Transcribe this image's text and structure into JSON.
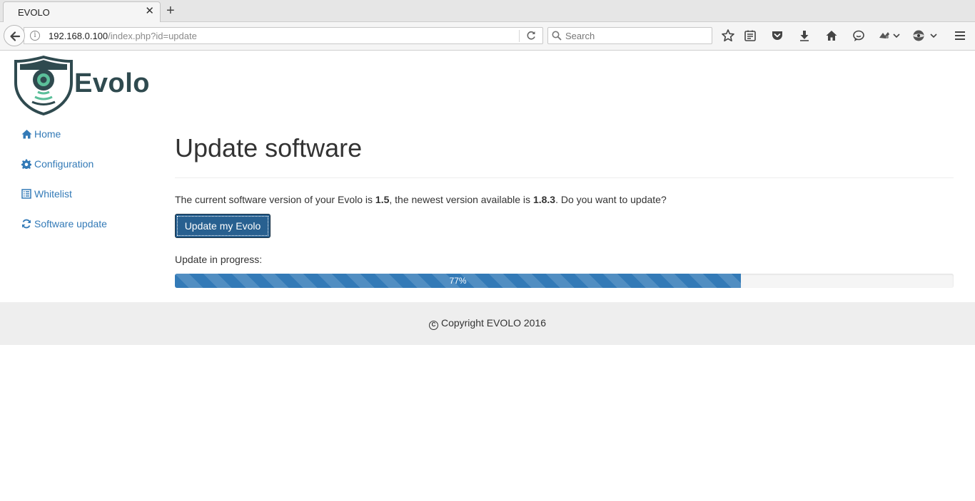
{
  "browser": {
    "tab_title": "EVOLO",
    "url_host": "192.168.0.100",
    "url_path": "/index.php?id=update",
    "search_placeholder": "Search"
  },
  "logo": {
    "text": "Evolo"
  },
  "sidebar": {
    "items": [
      {
        "label": "Home",
        "icon": "home-icon"
      },
      {
        "label": "Configuration",
        "icon": "gear-icon"
      },
      {
        "label": "Whitelist",
        "icon": "list-icon"
      },
      {
        "label": "Software update",
        "icon": "refresh-icon"
      }
    ]
  },
  "main": {
    "title": "Update software",
    "version_prefix": "The current software version of your Evolo is ",
    "current_version": "1.5",
    "version_middle": ", the newest version available is ",
    "newest_version": "1.8.3",
    "version_suffix": ". Do you want to update?",
    "update_button": "Update my Evolo",
    "progress_label": "Update in progress:",
    "progress_text": "77%",
    "progress_value": 0.727
  },
  "footer": {
    "text": "Copyright EVOLO 2016"
  },
  "colors": {
    "accent": "#337ab7",
    "button": "#286090",
    "logo": "#2f4a4f",
    "logo_accent": "#5bbf9a"
  }
}
